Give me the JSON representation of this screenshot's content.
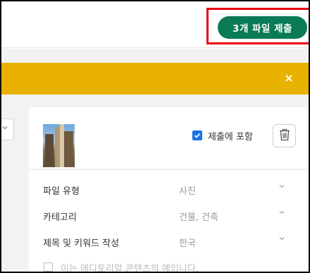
{
  "header": {
    "submit_label": "3개 파일 제출"
  },
  "banner": {
    "close_symbol": "×",
    "color": "#e9b201"
  },
  "file_card": {
    "include_label": "제출에 포함",
    "include_checked": true,
    "fields": [
      {
        "label": "파일 유형",
        "value": "사진"
      },
      {
        "label": "카테고리",
        "value": "건물, 건축"
      },
      {
        "label": "제목 및 키워드 작성",
        "value": "한국"
      }
    ],
    "editorial_label": "이는 에디토리얼 콘텐츠의 예입니다."
  },
  "colors": {
    "submit_button": "#0a7a57",
    "highlight_box": "#e8000e",
    "checkbox": "#1a73e8"
  }
}
